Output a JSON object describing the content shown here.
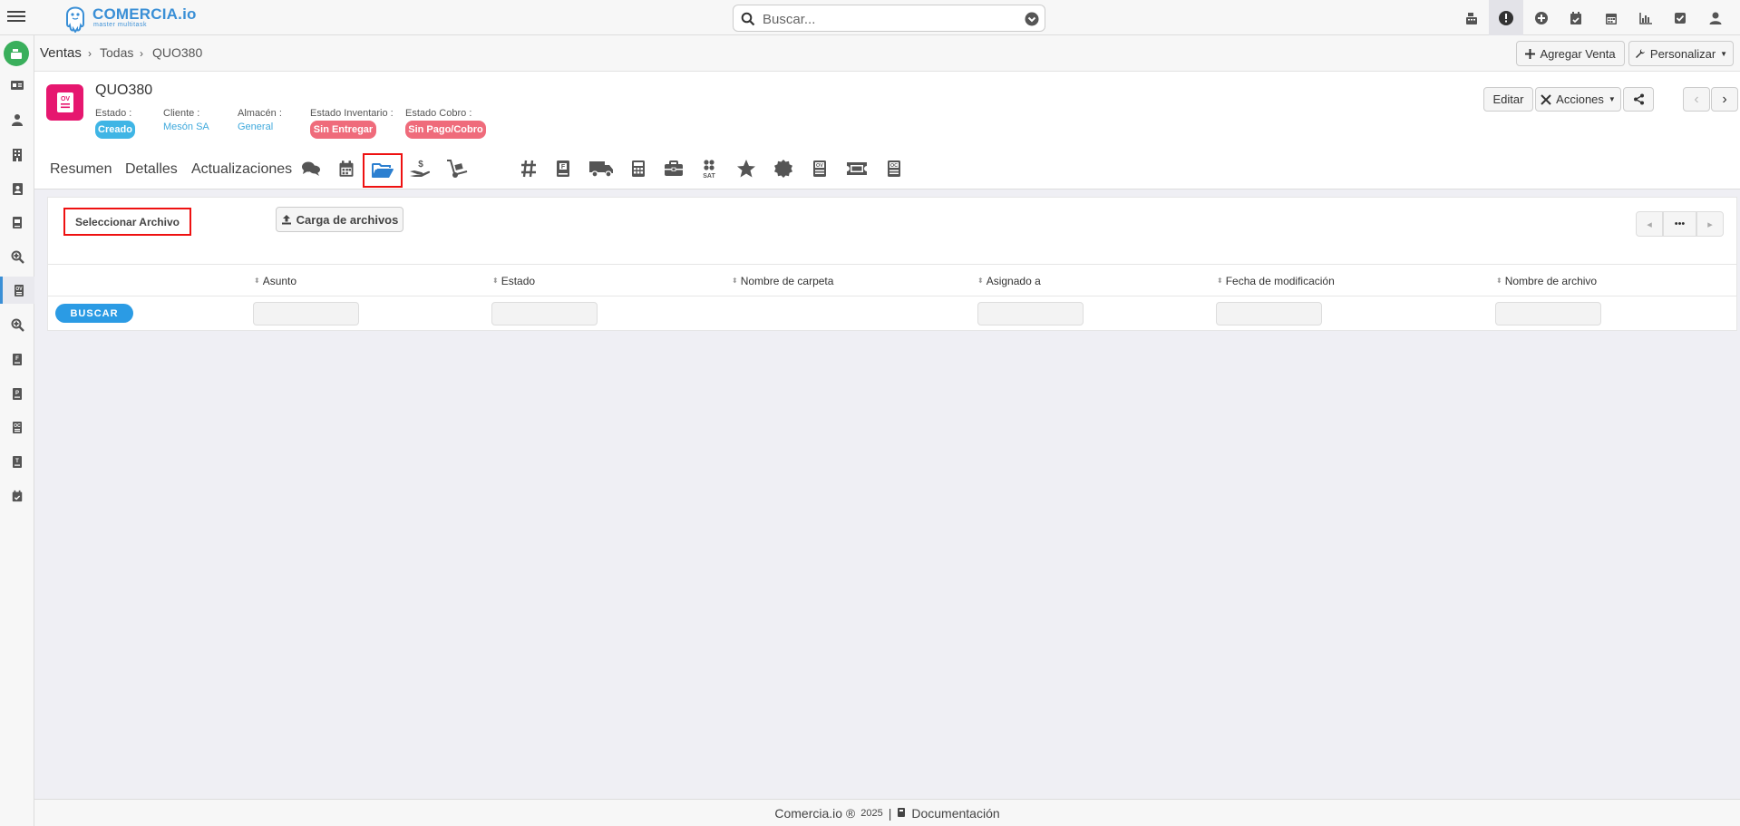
{
  "app": {
    "logo_text": "COMERCIA.io",
    "logo_tagline": "master multitask"
  },
  "search": {
    "placeholder": "Buscar..."
  },
  "topbar_icons": [
    "cash-register-icon",
    "alert-icon",
    "plus-circle-icon",
    "calendar-check-icon",
    "calendar-icon",
    "chart-icon",
    "checkbox-icon",
    "user-icon"
  ],
  "sidebar_icons": [
    "id-card-icon",
    "person-icon",
    "building-icon",
    "contact-card-icon",
    "book-icon",
    "search-zoom-icon",
    "ov-doc-icon",
    "search-zoom-icon",
    "f-doc-icon",
    "p-doc-icon",
    "oc-doc-icon",
    "t-doc-icon",
    "calendar-check-icon"
  ],
  "breadcrumb": {
    "items": [
      "Ventas",
      "Todas",
      "QUO380"
    ]
  },
  "header_actions": {
    "add_sale": "Agregar Venta",
    "customize": "Personalizar",
    "edit": "Editar",
    "actions": "Acciones"
  },
  "record": {
    "badge": "OV",
    "title": "QUO380",
    "estado_label": "Estado :",
    "estado_value": "Creado",
    "cliente_label": "Cliente :",
    "cliente_value": "Mesón SA",
    "almacen_label": "Almacén :",
    "almacen_value": "General",
    "inventario_label": "Estado Inventario :",
    "inventario_value": "Sin Entregar",
    "cobro_label": "Estado Cobro :",
    "cobro_value": "Sin Pago/Cobro"
  },
  "tabs": {
    "text": [
      "Resumen",
      "Detalles",
      "Actualizaciones"
    ],
    "icons": [
      "comments-icon",
      "calendar-icon",
      "folder-open-icon",
      "hand-dollar-icon",
      "dolly-icon",
      "hashtag-icon",
      "f-book-icon",
      "truck-icon",
      "calculator-icon",
      "briefcase-icon",
      "sat-icon",
      "star-icon",
      "certificate-icon",
      "ov-doc-icon",
      "ticket-icon",
      "oc-doc-icon"
    ],
    "active_icon": "folder-open-icon"
  },
  "files": {
    "select_file": "Seleccionar Archivo",
    "upload": "Carga de archivos",
    "pager_more": "•••",
    "columns": [
      "Asunto",
      "Estado",
      "Nombre de carpeta",
      "Asignado a",
      "Fecha de modificación",
      "Nombre de archivo"
    ],
    "search_button": "BUSCAR"
  },
  "footer": {
    "brand": "Comercia.io ®",
    "year": "2025",
    "separator": "|",
    "docs": "Documentación"
  },
  "colors": {
    "accent": "#3a8fd6",
    "badge_pink": "#e6176f",
    "pill_blue": "#3fb5e5",
    "pill_red": "#ef6b7b",
    "buscar_blue": "#2b9be4",
    "highlight_red": "#ee1111"
  }
}
